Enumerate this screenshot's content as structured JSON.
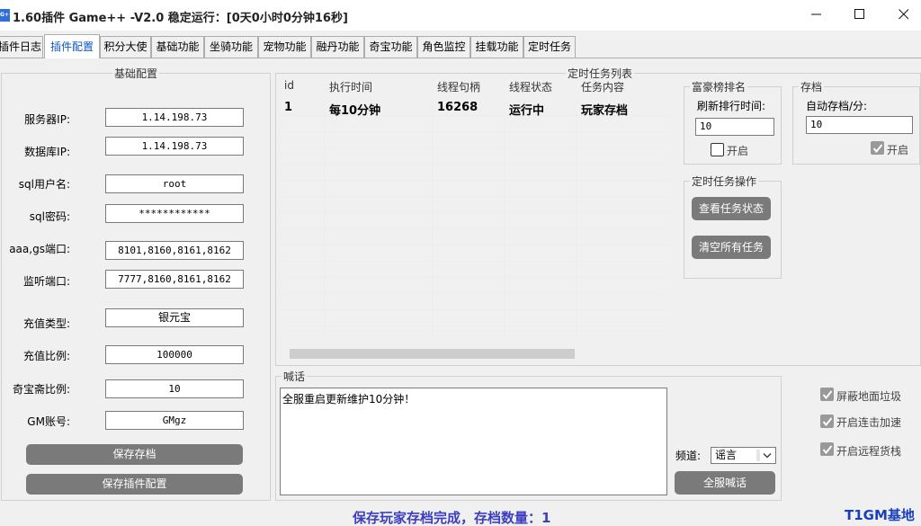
{
  "window": {
    "icon_text": "G++",
    "title": "1.60插件 Game++ -V2.0 稳定运行：[0天0小时0分钟16秒]"
  },
  "tabs": [
    {
      "label": "插件日志"
    },
    {
      "label": "插件配置"
    },
    {
      "label": "积分大使"
    },
    {
      "label": "基础功能"
    },
    {
      "label": "坐骑功能"
    },
    {
      "label": "宠物功能"
    },
    {
      "label": "融丹功能"
    },
    {
      "label": "奇宝功能"
    },
    {
      "label": "角色监控"
    },
    {
      "label": "挂载功能"
    },
    {
      "label": "定时任务"
    }
  ],
  "basic_config": {
    "title": "基础配置",
    "fields": [
      {
        "label": "服务器IP:",
        "value": "1.14.198.73"
      },
      {
        "label": "数据库IP:",
        "value": "1.14.198.73"
      },
      {
        "label": "sql用户名:",
        "value": "root"
      },
      {
        "label": "sql密码:",
        "value": "************"
      },
      {
        "label": "aaa,gs端口:",
        "value": "8101,8160,8161,8162"
      },
      {
        "label": "监听端口:",
        "value": "7777,8160,8161,8162"
      },
      {
        "label": "充值类型:",
        "value": "银元宝"
      },
      {
        "label": "充值比例:",
        "value": "100000"
      },
      {
        "label": "奇宝斋比例:",
        "value": "10"
      },
      {
        "label": "GM账号:",
        "value": "GMgz"
      }
    ],
    "save_archive_button": "保存存档",
    "save_plugin_button": "保存插件配置"
  },
  "task_list": {
    "title": "定时任务列表",
    "columns": [
      "id",
      "执行时间",
      "线程句柄",
      "线程状态",
      "任务内容"
    ],
    "rows": [
      {
        "id": "1",
        "time": "每10分钟",
        "handle": "16268",
        "status": "运行中",
        "content": "玩家存档"
      }
    ]
  },
  "rich_rank": {
    "title": "富豪榜排名",
    "refresh_label": "刷新排行时间:",
    "refresh_value": "10",
    "enable_label": "开启",
    "enabled": false
  },
  "archive": {
    "title": "存档",
    "auto_label": "自动存档/分:",
    "auto_value": "10",
    "enable_label": "开启",
    "enabled": true
  },
  "task_ops": {
    "title": "定时任务操作",
    "view_button": "查看任务状态",
    "clear_button": "清空所有任务"
  },
  "shout": {
    "title": "喊话",
    "message": "全服重启更新维护10分钟！",
    "channel_label": "频道:",
    "channel_value": "谣言",
    "send_button": "全服喊话"
  },
  "options": [
    {
      "label": "屏蔽地面垃圾",
      "checked": true
    },
    {
      "label": "开启连击加速",
      "checked": true
    },
    {
      "label": "开启远程货栈",
      "checked": true
    }
  ],
  "status_bar": {
    "message": "保存玩家存档完成，存档数量：1",
    "brand": "T1GM基地"
  },
  "colors": {
    "accent_tab": "#0b56c5",
    "status_text": "#3d3fc0",
    "brand": "#1a3ec0",
    "button_gray": "#7a7a7a"
  }
}
